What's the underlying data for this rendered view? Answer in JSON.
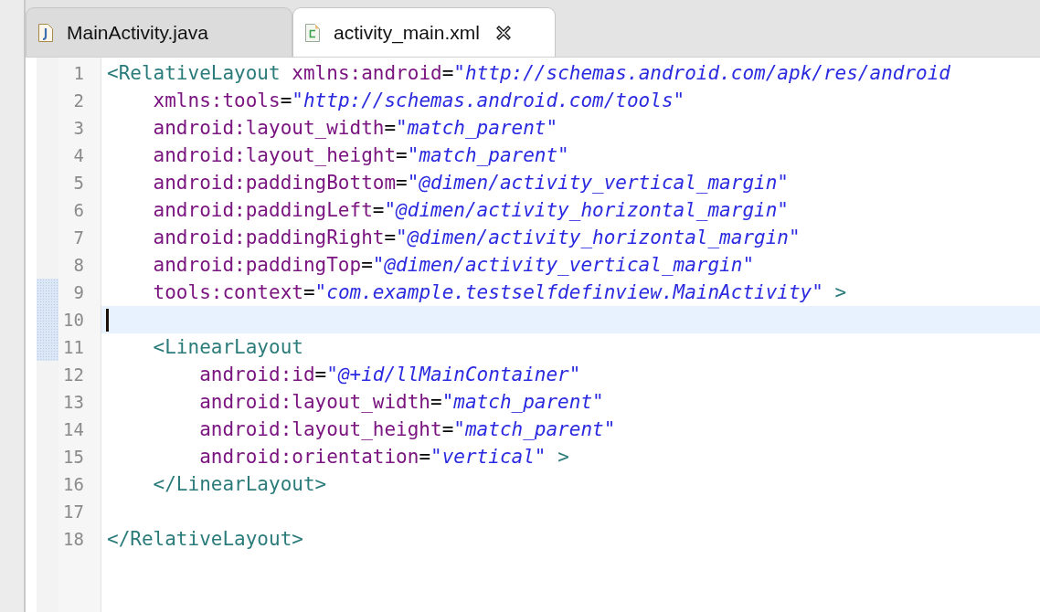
{
  "tabs": [
    {
      "label": "MainActivity.java",
      "kind": "java",
      "selected": false,
      "closable": false
    },
    {
      "label": "activity_main.xml",
      "kind": "xml",
      "selected": true,
      "closable": true
    }
  ],
  "editor": {
    "lines": [
      {
        "number": "1",
        "current": false,
        "changed": false,
        "tokens": [
          {
            "kind": "tag",
            "t": "<RelativeLayout"
          },
          {
            "kind": "attr",
            "t": " xmlns:android"
          },
          {
            "kind": "eq",
            "t": "="
          },
          {
            "kind": "value",
            "t": "\"http://schemas.android.com/apk/res/android"
          }
        ]
      },
      {
        "number": "2",
        "current": false,
        "changed": false,
        "tokens": [
          {
            "kind": "attr",
            "t": "    xmlns:tools"
          },
          {
            "kind": "eq",
            "t": "="
          },
          {
            "kind": "value",
            "t": "\"http://schemas.android.com/tools\""
          }
        ]
      },
      {
        "number": "3",
        "current": false,
        "changed": false,
        "tokens": [
          {
            "kind": "attr",
            "t": "    android:layout_width"
          },
          {
            "kind": "eq",
            "t": "="
          },
          {
            "kind": "value",
            "t": "\"match_parent\""
          }
        ]
      },
      {
        "number": "4",
        "current": false,
        "changed": false,
        "tokens": [
          {
            "kind": "attr",
            "t": "    android:layout_height"
          },
          {
            "kind": "eq",
            "t": "="
          },
          {
            "kind": "value",
            "t": "\"match_parent\""
          }
        ]
      },
      {
        "number": "5",
        "current": false,
        "changed": false,
        "tokens": [
          {
            "kind": "attr",
            "t": "    android:paddingBottom"
          },
          {
            "kind": "eq",
            "t": "="
          },
          {
            "kind": "value",
            "t": "\"@dimen/activity_vertical_margin\""
          }
        ]
      },
      {
        "number": "6",
        "current": false,
        "changed": false,
        "tokens": [
          {
            "kind": "attr",
            "t": "    android:paddingLeft"
          },
          {
            "kind": "eq",
            "t": "="
          },
          {
            "kind": "value",
            "t": "\"@dimen/activity_horizontal_margin\""
          }
        ]
      },
      {
        "number": "7",
        "current": false,
        "changed": false,
        "tokens": [
          {
            "kind": "attr",
            "t": "    android:paddingRight"
          },
          {
            "kind": "eq",
            "t": "="
          },
          {
            "kind": "value",
            "t": "\"@dimen/activity_horizontal_margin\""
          }
        ]
      },
      {
        "number": "8",
        "current": false,
        "changed": false,
        "tokens": [
          {
            "kind": "attr",
            "t": "    android:paddingTop"
          },
          {
            "kind": "eq",
            "t": "="
          },
          {
            "kind": "value",
            "t": "\"@dimen/activity_vertical_margin\""
          }
        ]
      },
      {
        "number": "9",
        "current": false,
        "changed": true,
        "tokens": [
          {
            "kind": "attr",
            "t": "    tools:context"
          },
          {
            "kind": "eq",
            "t": "="
          },
          {
            "kind": "value",
            "t": "\"com.example.testselfdefinview.MainActivity\""
          },
          {
            "kind": "tag",
            "t": " >"
          }
        ]
      },
      {
        "number": "10",
        "current": true,
        "changed": true
      },
      {
        "number": "11",
        "current": false,
        "changed": true,
        "tokens": [
          {
            "kind": "tag",
            "t": "    <LinearLayout"
          }
        ]
      },
      {
        "number": "12",
        "current": false,
        "changed": false,
        "tokens": [
          {
            "kind": "attr",
            "t": "        android:id"
          },
          {
            "kind": "eq",
            "t": "="
          },
          {
            "kind": "value",
            "t": "\"@+id/llMainContainer\""
          }
        ]
      },
      {
        "number": "13",
        "current": false,
        "changed": false,
        "tokens": [
          {
            "kind": "attr",
            "t": "        android:layout_width"
          },
          {
            "kind": "eq",
            "t": "="
          },
          {
            "kind": "value",
            "t": "\"match_parent\""
          }
        ]
      },
      {
        "number": "14",
        "current": false,
        "changed": false,
        "tokens": [
          {
            "kind": "attr",
            "t": "        android:layout_height"
          },
          {
            "kind": "eq",
            "t": "="
          },
          {
            "kind": "value",
            "t": "\"match_parent\""
          }
        ]
      },
      {
        "number": "15",
        "current": false,
        "changed": false,
        "tokens": [
          {
            "kind": "attr",
            "t": "        android:orientation"
          },
          {
            "kind": "eq",
            "t": "="
          },
          {
            "kind": "value",
            "t": "\"vertical\""
          },
          {
            "kind": "tag",
            "t": " >"
          }
        ]
      },
      {
        "number": "16",
        "current": false,
        "changed": false,
        "tokens": [
          {
            "kind": "tag",
            "t": "    </LinearLayout>"
          }
        ]
      },
      {
        "number": "17",
        "current": false,
        "changed": false
      },
      {
        "number": "18",
        "current": false,
        "changed": false,
        "tokens": [
          {
            "kind": "tag",
            "t": "</RelativeLayout>"
          }
        ]
      }
    ]
  }
}
